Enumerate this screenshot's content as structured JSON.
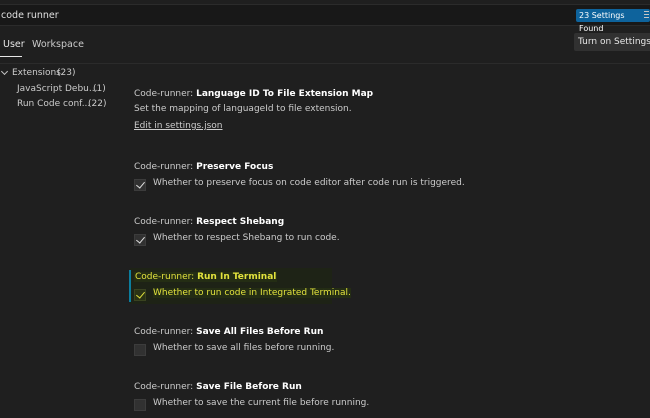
{
  "search": {
    "query": "code runner",
    "results_badge": "23 Settings Found",
    "filter_icon": "filter-lines-icon"
  },
  "tabs": [
    {
      "label": "User",
      "active": true
    },
    {
      "label": "Workspace",
      "active": false
    }
  ],
  "sync_button": "Turn on Settings S",
  "toc": {
    "group": {
      "label": "Extensions",
      "count": "(23)"
    },
    "items": [
      {
        "label": "JavaScript Debu...",
        "count": "(1)"
      },
      {
        "label": "Run Code conf...",
        "count": "(22)"
      }
    ]
  },
  "settings": [
    {
      "category": "Code-runner:",
      "name": "Language ID To File Extension Map",
      "description": "Set the mapping of languageId to file extension.",
      "link": "Edit in settings.json"
    },
    {
      "category": "Code-runner:",
      "name": "Preserve Focus",
      "description": "Whether to preserve focus on code editor after code run is triggered.",
      "checked": true
    },
    {
      "category": "Code-runner:",
      "name": "Respect Shebang",
      "description": "Whether to respect Shebang to run code.",
      "checked": true
    },
    {
      "category": "Code-runner:",
      "name": "Run In Terminal",
      "description": "Whether to run code in Integrated Terminal.",
      "checked": true,
      "modified": true
    },
    {
      "category": "Code-runner:",
      "name": "Save All Files Before Run",
      "description": "Whether to save all files before running.",
      "checked": false
    },
    {
      "category": "Code-runner:",
      "name": "Save File Before Run",
      "description": "Whether to save the current file before running.",
      "checked": false
    }
  ],
  "colors": {
    "background": "#1f1f1f",
    "badge": "#0e639c",
    "modified_text": "#e2e23d",
    "modified_indicator": "#0c7d9d"
  }
}
